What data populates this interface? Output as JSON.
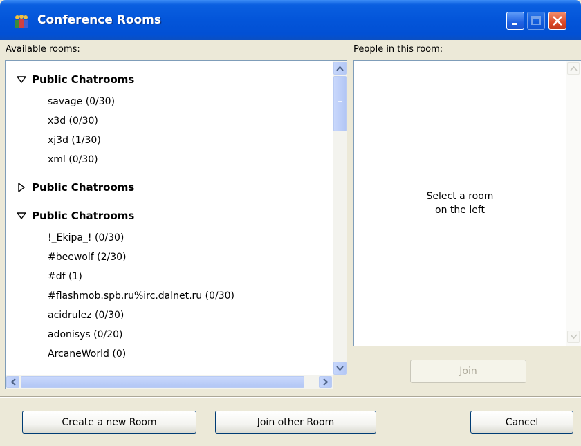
{
  "window": {
    "title": "Conference Rooms",
    "icon": "conference-people-icon"
  },
  "labels": {
    "available_rooms": "Available rooms:",
    "people_in_room": "People in this room:"
  },
  "room_tree": {
    "groups": [
      {
        "label": "Public Chatrooms",
        "expanded": true,
        "rooms": [
          "savage (0/30)",
          "x3d (0/30)",
          "xj3d (1/30)",
          "xml (0/30)"
        ]
      },
      {
        "label": "Public Chatrooms",
        "expanded": false,
        "rooms": []
      },
      {
        "label": "Public Chatrooms",
        "expanded": true,
        "rooms": [
          "!_Ekipa_! (0/30)",
          "#beewolf (2/30)",
          "#df (1)",
          "#flashmob.spb.ru%irc.dalnet.ru (0/30)",
          "acidrulez (0/30)",
          "adonisys (0/20)",
          "ArcaneWorld (0)"
        ]
      }
    ]
  },
  "people_panel": {
    "empty_line1": "Select a room",
    "empty_line2": "on the left"
  },
  "buttons": {
    "join": "Join",
    "create_room": "Create a new Room",
    "join_other": "Join other Room",
    "cancel": "Cancel"
  },
  "colors": {
    "titlebar_blue": "#0355d9",
    "panel_border": "#7f9db9",
    "dialog_bg": "#ece9d8"
  }
}
